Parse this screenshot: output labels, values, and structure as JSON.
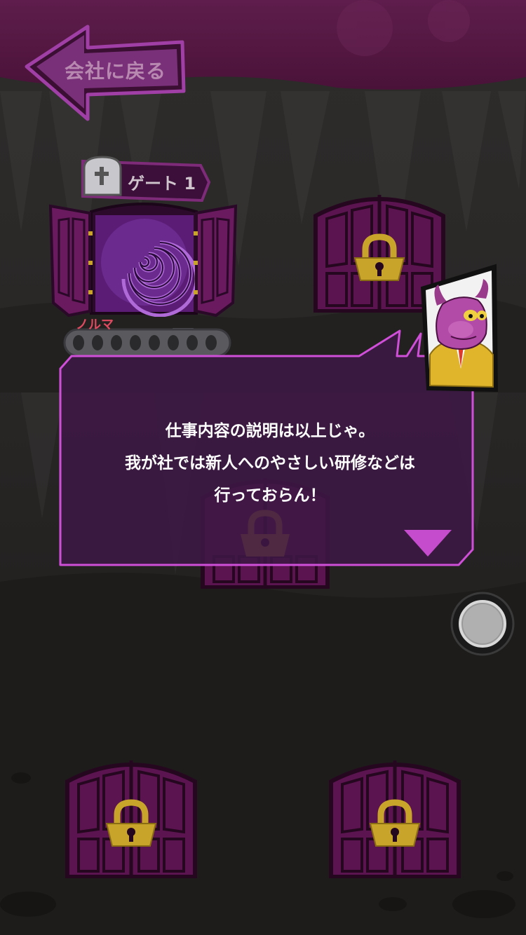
{
  "header": {
    "back_label": "会社に戻る"
  },
  "gate": {
    "label": "ゲート 1",
    "norma_label": "ノルマ",
    "norma_filled": 0,
    "norma_total": 8
  },
  "dialog": {
    "lines": [
      "仕事内容の説明は以上じゃ。",
      "我が社では新人へのやさしい研修などは",
      "行っておらん！"
    ]
  },
  "colors": {
    "accent": "#d04fd8",
    "door_purple": "#5c1450",
    "lock_gold": "#c9a42a",
    "dialog_bg": "#3d1844",
    "norma_red": "#e04a60"
  },
  "icons": {
    "back": "left-arrow-icon",
    "gate_badge": "tombstone-icon",
    "lock": "padlock-icon",
    "next": "triangle-down-icon"
  }
}
